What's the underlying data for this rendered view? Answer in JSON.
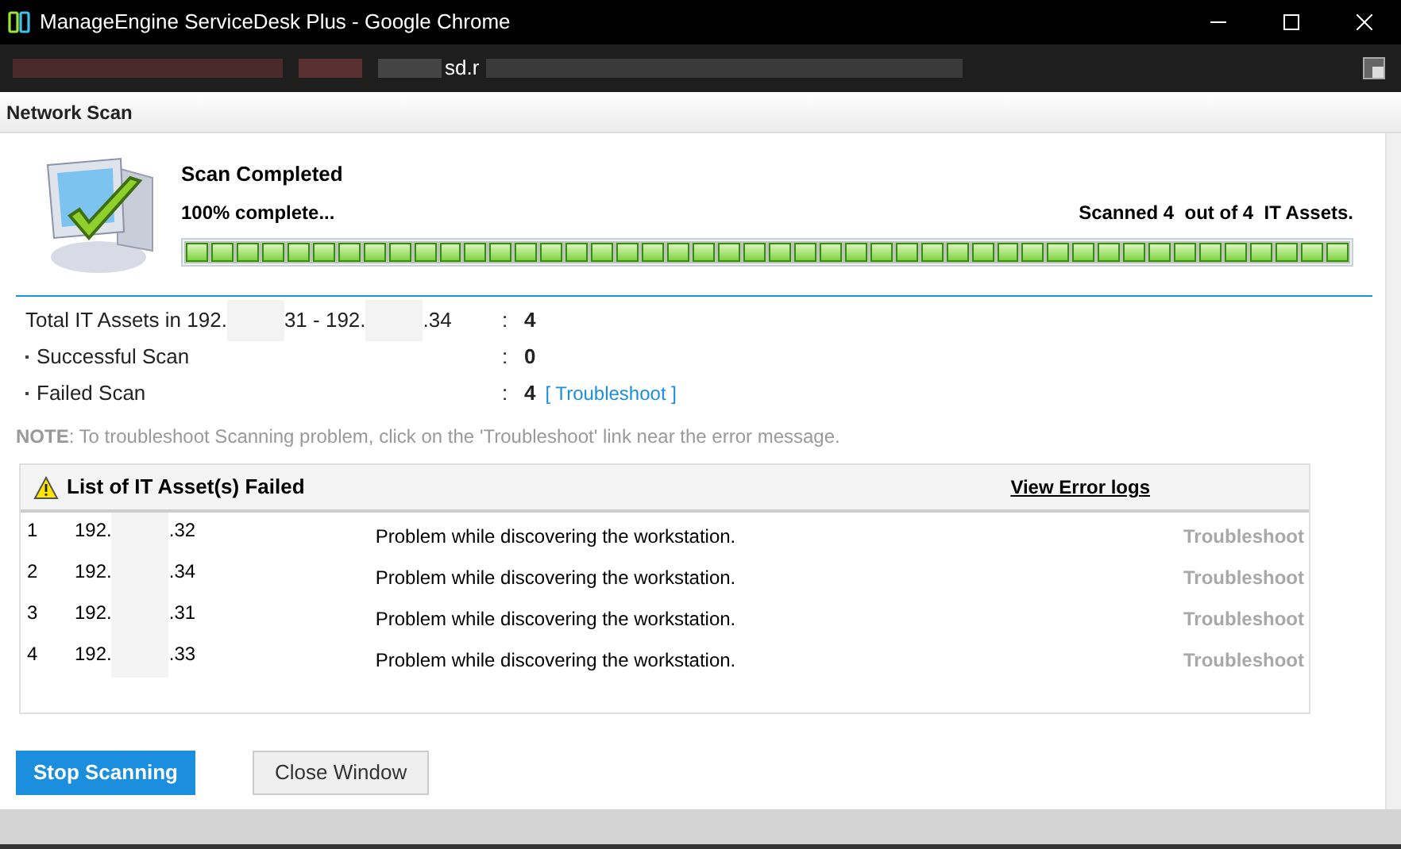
{
  "window": {
    "title": "ManageEngine ServiceDesk Plus - Google Chrome"
  },
  "address_bar": {
    "visible_text": "sd.r"
  },
  "panel": {
    "title": "Network Scan"
  },
  "scan": {
    "status": "Scan Completed",
    "percent": "100% complete...",
    "scanned": "Scanned 4  out of 4  IT Assets.",
    "level": 1
  },
  "summary": [
    {
      "label_parts": [
        "Total IT Assets in 192.",
        "31 - 192.",
        ".34"
      ],
      "bullet": false,
      "separator": ":",
      "value": "4"
    },
    {
      "label_parts": [
        "Successful Scan"
      ],
      "bullet": true,
      "separator": ":",
      "value": "0"
    },
    {
      "label_parts": [
        "Failed Scan"
      ],
      "bullet": true,
      "separator": ":",
      "value": "4",
      "link": "[ Troubleshoot ]"
    }
  ],
  "note": {
    "prefix": "NOTE",
    "text": ": To troubleshoot Scanning problem, click on the 'Troubleshoot' link near the error message."
  },
  "failed_list": {
    "title": "List of IT Asset(s) Failed",
    "error_logs_link": "View Error logs",
    "rows": [
      {
        "index": "1",
        "ip_start": "192.",
        "ip_end": ".32",
        "message": "Problem while discovering the workstation.",
        "action": "Troubleshoot"
      },
      {
        "index": "2",
        "ip_start": "192.",
        "ip_end": ".34",
        "message": "Problem while discovering the workstation.",
        "action": "Troubleshoot"
      },
      {
        "index": "3",
        "ip_start": "192.",
        "ip_end": ".31",
        "message": "Problem while discovering the workstation.",
        "action": "Troubleshoot"
      },
      {
        "index": "4",
        "ip_start": "192.",
        "ip_end": ".33",
        "message": "Problem while discovering the workstation.",
        "action": "Troubleshoot"
      }
    ]
  },
  "buttons": [
    {
      "kind": "primary",
      "label": "Stop Scanning"
    },
    {
      "kind": "secondary",
      "label": "Close Window"
    }
  ]
}
